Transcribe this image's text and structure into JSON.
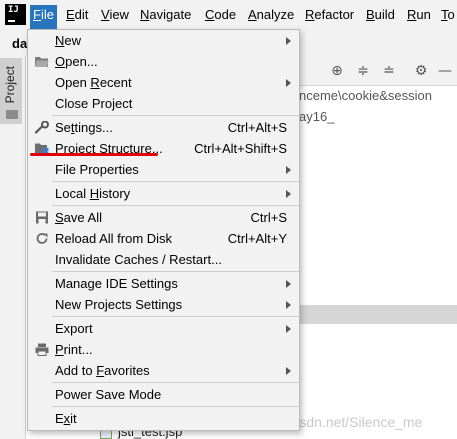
{
  "menubar": {
    "logo_text": "IJ",
    "items": [
      {
        "label": "File",
        "mnemonic_index": 0
      },
      {
        "label": "Edit",
        "mnemonic_index": 0
      },
      {
        "label": "View",
        "mnemonic_index": 0
      },
      {
        "label": "Navigate",
        "mnemonic_index": 0
      },
      {
        "label": "Code",
        "mnemonic_index": 0
      },
      {
        "label": "Analyze",
        "mnemonic_index": 0
      },
      {
        "label": "Refactor",
        "mnemonic_index": 0
      },
      {
        "label": "Build",
        "mnemonic_index": 0
      },
      {
        "label": "Run",
        "mnemonic_index": 0
      },
      {
        "label": "To",
        "mnemonic_index": 0
      }
    ]
  },
  "project_crumb": "day",
  "left_panel_tab": "Project",
  "background": {
    "path_text_1": "nceme\\cookie&session",
    "path_text_2": "ay16_",
    "file_name": "jstl_test.jsp",
    "watermark": "https://blog.csdn.net/Silence_me"
  },
  "file_menu": {
    "items": {
      "new": {
        "label": "New",
        "u": "N"
      },
      "open": {
        "label": "Open...",
        "u": "O"
      },
      "open_recent": {
        "label": "Open Recent",
        "u": "R"
      },
      "close_project": {
        "label": "Close Project",
        "u": ""
      },
      "settings": {
        "label": "Settings...",
        "u": "t",
        "shortcut": "Ctrl+Alt+S"
      },
      "project_structure": {
        "label": "Project Structure...",
        "u": "r",
        "shortcut": "Ctrl+Alt+Shift+S"
      },
      "file_properties": {
        "label": "File Properties",
        "u": ""
      },
      "local_history": {
        "label": "Local History",
        "u": "H"
      },
      "save_all": {
        "label": "Save All",
        "u": "S",
        "shortcut": "Ctrl+S"
      },
      "reload": {
        "label": "Reload All from Disk",
        "u": "",
        "shortcut": "Ctrl+Alt+Y"
      },
      "invalidate": {
        "label": "Invalidate Caches / Restart...",
        "u": ""
      },
      "manage_ide": {
        "label": "Manage IDE Settings",
        "u": ""
      },
      "new_projects_settings": {
        "label": "New Projects Settings",
        "u": ""
      },
      "export": {
        "label": "Export",
        "u": ""
      },
      "print": {
        "label": "Print...",
        "u": "P"
      },
      "add_favorites": {
        "label": "Add to Favorites",
        "u": "F"
      },
      "power_save": {
        "label": "Power Save Mode",
        "u": ""
      },
      "exit": {
        "label": "Exit",
        "u": "x"
      }
    }
  },
  "colors": {
    "menu_active": "#2675bf",
    "highlight_underline": "#e00000"
  }
}
